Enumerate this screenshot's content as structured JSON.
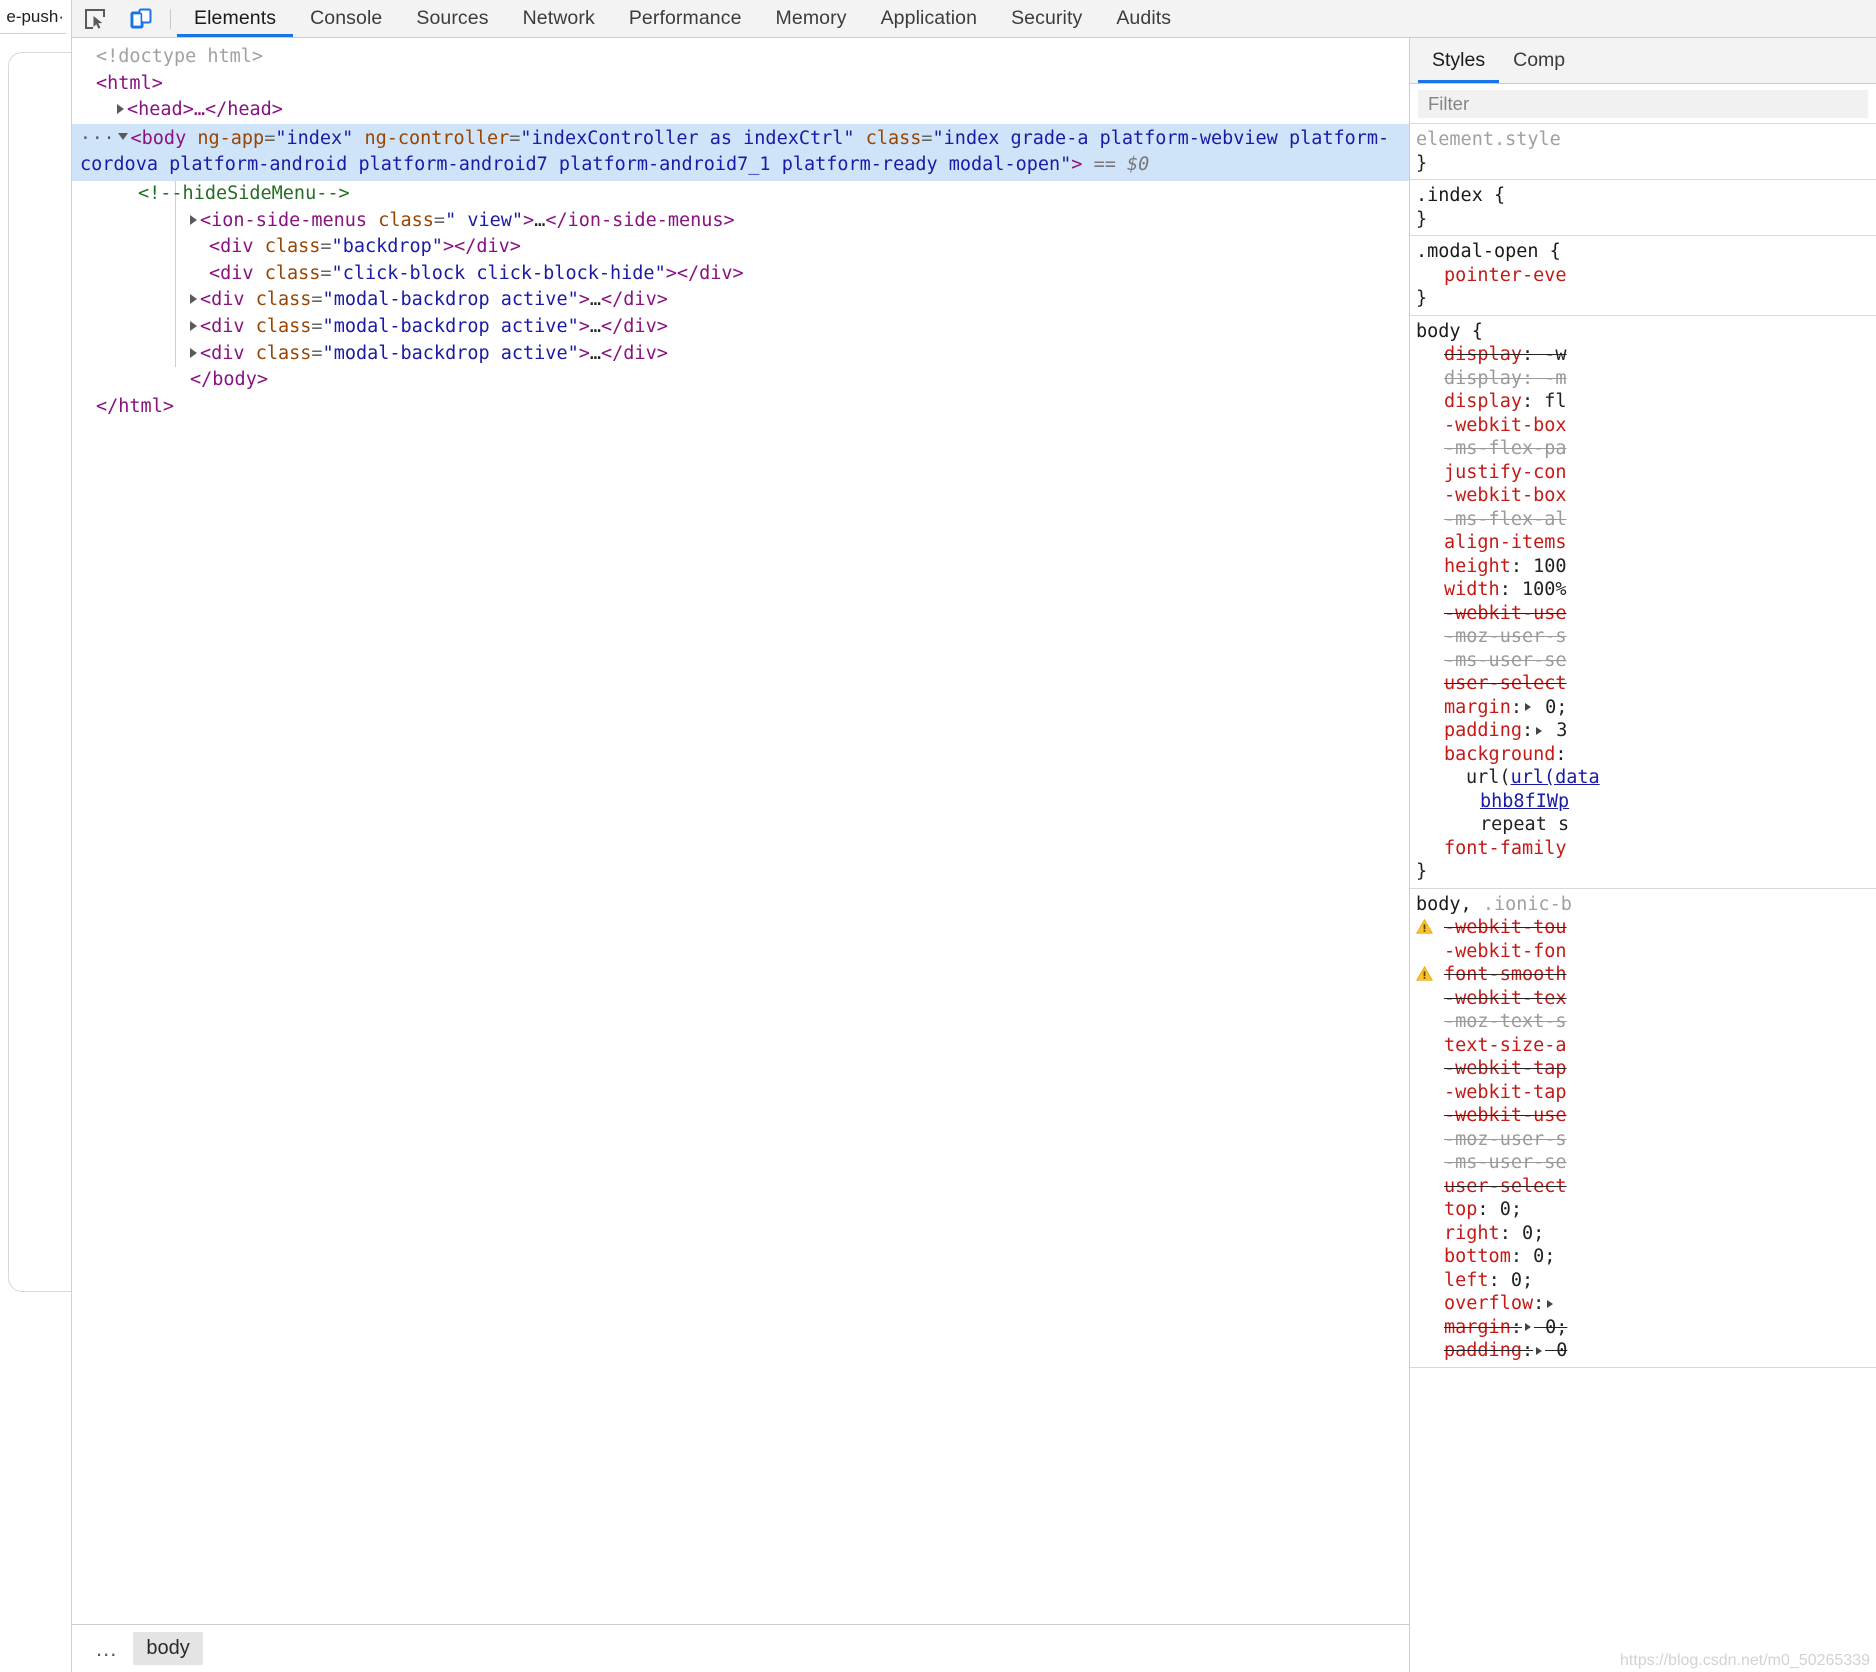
{
  "page_remnant": {
    "tab_label": "e-push·"
  },
  "toolbar": {
    "inspect_icon": "inspect-cursor-icon",
    "device_icon": "device-toolbar-icon",
    "tabs": [
      {
        "label": "Elements",
        "active": true
      },
      {
        "label": "Console",
        "active": false
      },
      {
        "label": "Sources",
        "active": false
      },
      {
        "label": "Network",
        "active": false
      },
      {
        "label": "Performance",
        "active": false
      },
      {
        "label": "Memory",
        "active": false
      },
      {
        "label": "Application",
        "active": false
      },
      {
        "label": "Security",
        "active": false
      },
      {
        "label": "Audits",
        "active": false
      }
    ]
  },
  "dom_tree": {
    "doctype": "<!doctype html>",
    "html_open": "<html>",
    "head_collapsed": "<head>…</head>",
    "body": {
      "tag": "body",
      "attrs": [
        {
          "name": "ng-app",
          "value": "index"
        },
        {
          "name": "ng-controller",
          "value": "indexController as indexCtrl"
        },
        {
          "name": "class",
          "value": "index grade-a platform-webview platform-cordova platform-android platform-android7 platform-android7_1 platform-ready modal-open"
        }
      ],
      "selected_marker": "== $0"
    },
    "children": [
      {
        "type": "comment",
        "text": "<!--hideSideMenu-->"
      },
      {
        "type": "element",
        "expandable": true,
        "tag": "ion-side-menus",
        "attr_name": "class",
        "attr_value": " view",
        "collapsed": true,
        "close_tag": "</ion-side-menus>"
      },
      {
        "type": "element",
        "expandable": false,
        "tag": "div",
        "attr_name": "class",
        "attr_value": "backdrop",
        "collapsed": false,
        "close_tag": "</div>"
      },
      {
        "type": "element",
        "expandable": false,
        "tag": "div",
        "attr_name": "class",
        "attr_value": "click-block click-block-hide",
        "collapsed": false,
        "close_tag": "</div>"
      },
      {
        "type": "element",
        "expandable": true,
        "tag": "div",
        "attr_name": "class",
        "attr_value": "modal-backdrop active",
        "collapsed": true,
        "close_tag": "</div>"
      },
      {
        "type": "element",
        "expandable": true,
        "tag": "div",
        "attr_name": "class",
        "attr_value": "modal-backdrop active",
        "collapsed": true,
        "close_tag": "</div>"
      },
      {
        "type": "element",
        "expandable": true,
        "tag": "div",
        "attr_name": "class",
        "attr_value": "modal-backdrop active",
        "collapsed": true,
        "close_tag": "</div>"
      }
    ],
    "body_close": "</body>",
    "html_close": "</html>"
  },
  "breadcrumb": {
    "ellipsis": "...",
    "items": [
      "body"
    ]
  },
  "styles_panel": {
    "tabs": [
      {
        "label": "Styles",
        "active": true
      },
      {
        "label": "Comp",
        "active": false
      }
    ],
    "filter_placeholder": "Filter",
    "rules": [
      {
        "selector": "element.style",
        "selector_style": "dim",
        "open_brace": "{",
        "declarations": [],
        "close_brace": "}"
      },
      {
        "selector": ".index",
        "selector_style": "normal",
        "open_brace": "{",
        "declarations": [],
        "close_brace": "}"
      },
      {
        "selector": ".modal-open",
        "selector_style": "normal",
        "open_brace": "{",
        "declarations": [
          {
            "prop": "pointer-eve",
            "value": "",
            "state": "normal",
            "truncated": true
          }
        ],
        "close_brace": "}"
      },
      {
        "selector": "body",
        "selector_style": "normal",
        "open_brace": "{",
        "declarations": [
          {
            "prop": "display",
            "value": " -w",
            "state": "overridden",
            "truncated": true
          },
          {
            "prop": "display",
            "value": " -m",
            "state": "inactive-overridden",
            "truncated": true
          },
          {
            "prop": "display",
            "value": " fl",
            "state": "normal",
            "truncated": true
          },
          {
            "prop": "-webkit-box",
            "value": "",
            "state": "normal",
            "truncated": true
          },
          {
            "prop": "-ms-flex-pa",
            "value": "",
            "state": "inactive-overridden",
            "truncated": true
          },
          {
            "prop": "justify-con",
            "value": "",
            "state": "normal",
            "truncated": true
          },
          {
            "prop": "-webkit-box",
            "value": "",
            "state": "normal",
            "truncated": true
          },
          {
            "prop": "-ms-flex-al",
            "value": "",
            "state": "inactive-overridden",
            "truncated": true
          },
          {
            "prop": "align-items",
            "value": "",
            "state": "normal",
            "truncated": true
          },
          {
            "prop": "height",
            "value": " 100",
            "state": "normal",
            "truncated": true
          },
          {
            "prop": "width",
            "value": " 100%",
            "state": "normal",
            "truncated": true
          },
          {
            "prop": "-webkit-use",
            "value": "",
            "state": "overridden",
            "truncated": true
          },
          {
            "prop": "-moz-user-s",
            "value": "",
            "state": "inactive-overridden",
            "truncated": true
          },
          {
            "prop": "-ms-user-se",
            "value": "",
            "state": "inactive-overridden",
            "truncated": true
          },
          {
            "prop": "user-select",
            "value": "",
            "state": "overridden",
            "truncated": true
          },
          {
            "prop": "margin",
            "value": " 0;",
            "state": "normal",
            "expandable": true
          },
          {
            "prop": "padding",
            "value": " 3",
            "state": "normal",
            "expandable": true
          },
          {
            "prop": "background",
            "value": "",
            "state": "normal",
            "truncated": true
          },
          {
            "prop": "",
            "value": "url(data",
            "state": "link-line"
          },
          {
            "prop": "",
            "value": "bhb8fIWp",
            "state": "link-line"
          },
          {
            "prop": "",
            "value": "repeat s",
            "state": "plain-line"
          },
          {
            "prop": "font-family",
            "value": "",
            "state": "normal",
            "truncated": true
          }
        ],
        "close_brace": "}"
      },
      {
        "selector": "body, ",
        "selector_extra": ".ionic-b",
        "selector_style": "mixed",
        "open_brace": "",
        "declarations": [
          {
            "prop": "-webkit-tou",
            "value": "",
            "state": "overridden",
            "warn": true,
            "truncated": true
          },
          {
            "prop": "-webkit-fon",
            "value": "",
            "state": "normal",
            "truncated": true
          },
          {
            "prop": "font-smooth",
            "value": "",
            "state": "overridden",
            "warn": true,
            "truncated": true
          },
          {
            "prop": "-webkit-tex",
            "value": "",
            "state": "overridden",
            "truncated": true
          },
          {
            "prop": "-moz-text-s",
            "value": "",
            "state": "inactive-overridden",
            "truncated": true
          },
          {
            "prop": "text-size-a",
            "value": "",
            "state": "normal",
            "truncated": true
          },
          {
            "prop": "-webkit-tap",
            "value": "",
            "state": "overridden",
            "truncated": true
          },
          {
            "prop": "-webkit-tap",
            "value": "",
            "state": "normal",
            "truncated": true
          },
          {
            "prop": "-webkit-use",
            "value": "",
            "state": "overridden",
            "truncated": true
          },
          {
            "prop": "-moz-user-s",
            "value": "",
            "state": "inactive-overridden",
            "truncated": true
          },
          {
            "prop": "-ms-user-se",
            "value": "",
            "state": "inactive-overridden",
            "truncated": true
          },
          {
            "prop": "user-select",
            "value": "",
            "state": "overridden",
            "truncated": true
          },
          {
            "prop": "top",
            "value": " 0;",
            "state": "normal"
          },
          {
            "prop": "right",
            "value": " 0;",
            "state": "normal"
          },
          {
            "prop": "bottom",
            "value": " 0;",
            "state": "normal"
          },
          {
            "prop": "left",
            "value": " 0;",
            "state": "normal"
          },
          {
            "prop": "overflow",
            "value": "",
            "state": "normal",
            "expandable": true
          },
          {
            "prop": "margin",
            "value": " 0;",
            "state": "overridden",
            "expandable": true
          },
          {
            "prop": "padding",
            "value": " 0",
            "state": "overridden",
            "expandable": true
          }
        ],
        "close_brace": ""
      }
    ]
  },
  "watermark": "https://blog.csdn.net/m0_50265339",
  "colors": {
    "accent": "#1a73e8",
    "selection": "#cfe3f9",
    "tag": "#881280",
    "attr_name": "#994500",
    "attr_value": "#1a1aa6",
    "comment": "#236e25",
    "css_prop": "#c41a16",
    "toolbar_bg": "#f3f3f3"
  }
}
